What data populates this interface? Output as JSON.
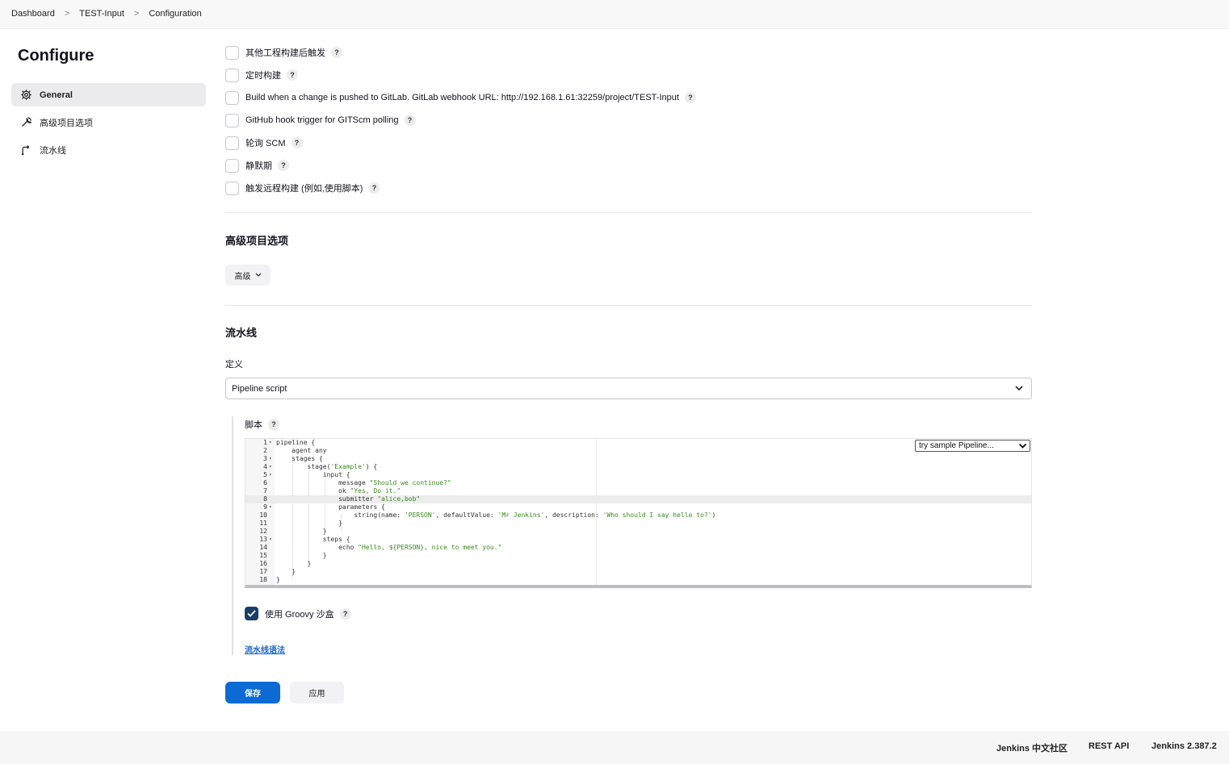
{
  "breadcrumb": {
    "items": [
      "Dashboard",
      "TEST-Input",
      "Configuration"
    ],
    "separator": ">"
  },
  "sidebar": {
    "title": "Configure",
    "items": [
      {
        "label": "General",
        "icon": "gear-icon",
        "active": true
      },
      {
        "label": "高级项目选项",
        "icon": "wrench-icon",
        "active": false
      },
      {
        "label": "流水线",
        "icon": "pipeline-icon",
        "active": false
      }
    ]
  },
  "triggers": [
    {
      "label": "其他工程构建后触发",
      "checked": false
    },
    {
      "label": "定时构建",
      "checked": false
    },
    {
      "label": "Build when a change is pushed to GitLab. GitLab webhook URL: http://192.168.1.61:32259/project/TEST-Input",
      "checked": false
    },
    {
      "label": "GitHub hook trigger for GITScm polling",
      "checked": false
    },
    {
      "label": "轮询 SCM",
      "checked": false
    },
    {
      "label": "静默期",
      "checked": false
    },
    {
      "label": "触发远程构建 (例如,使用脚本)",
      "checked": false
    }
  ],
  "help_glyph": "?",
  "advanced_section": {
    "title": "高级项目选项",
    "button_label": "高级"
  },
  "pipeline_section": {
    "title": "流水线",
    "definition_label": "定义",
    "definition_value": "Pipeline script",
    "script_label": "脚本",
    "sample_select": "try sample Pipeline...",
    "groovy_label": "使用 Groovy 沙盒",
    "groovy_checked": true,
    "syntax_link": "流水线语法"
  },
  "script_lines": [
    {
      "n": "1",
      "fold": true,
      "text": "pipeline {"
    },
    {
      "n": "2",
      "fold": false,
      "text": "    agent any"
    },
    {
      "n": "3",
      "fold": true,
      "text": "    stages {"
    },
    {
      "n": "4",
      "fold": true,
      "text": "        stage(",
      "str": "'Example'",
      "tail": ") {"
    },
    {
      "n": "5",
      "fold": true,
      "text": "            input {"
    },
    {
      "n": "6",
      "fold": false,
      "text": "                message ",
      "str": "\"Should we continue?\"",
      "tail": ""
    },
    {
      "n": "7",
      "fold": false,
      "text": "                ok ",
      "str": "\"Yes, Do it.\"",
      "tail": ""
    },
    {
      "n": "8",
      "fold": false,
      "text": "                submitter ",
      "str": "\"alice,bob\"",
      "tail": "",
      "highlight": true
    },
    {
      "n": "9",
      "fold": true,
      "text": "                parameters {"
    },
    {
      "n": "10",
      "fold": false,
      "text": "                    string(name: ",
      "str": "'PERSON'",
      "tail": ", defaultValue: ",
      "str2": "'Mr Jenkins'",
      "tail2": ", description: ",
      "str3": "'Who should I say hello to?'",
      "tail3": ")"
    },
    {
      "n": "11",
      "fold": false,
      "text": "                }"
    },
    {
      "n": "12",
      "fold": false,
      "text": "            }"
    },
    {
      "n": "13",
      "fold": true,
      "text": "            steps {"
    },
    {
      "n": "14",
      "fold": false,
      "text": "                echo ",
      "str": "\"Hello, ${PERSON}, nice to meet you.\"",
      "tail": ""
    },
    {
      "n": "15",
      "fold": false,
      "text": "            }"
    },
    {
      "n": "16",
      "fold": false,
      "text": "        }"
    },
    {
      "n": "17",
      "fold": false,
      "text": "    }"
    },
    {
      "n": "18",
      "fold": false,
      "text": "}"
    }
  ],
  "actions": {
    "save_label": "保存",
    "apply_label": "应用"
  },
  "footer": {
    "community": "Jenkins 中文社区",
    "rest_api": "REST API",
    "version": "Jenkins 2.387.2"
  },
  "colors": {
    "primary": "#0b6bd3",
    "checkbox_checked": "#1a3e6b",
    "link": "#1a63c9",
    "code_string": "#3a8a1b"
  }
}
